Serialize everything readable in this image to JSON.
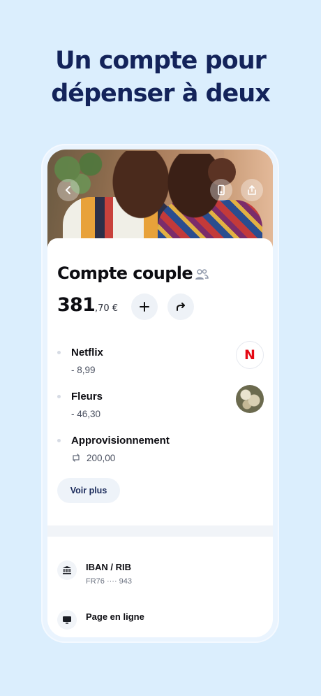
{
  "headline": {
    "line1": "Un compte pour",
    "line2": "dépenser à deux"
  },
  "colors": {
    "background": "#dbeefd",
    "headline": "#13235a",
    "netflix": "#e50914"
  },
  "account": {
    "title": "Compte couple",
    "balance_int": "381",
    "balance_dec": ",70 €"
  },
  "transactions": [
    {
      "name": "Netflix",
      "amount": "- 8,99",
      "thumb_text": "N",
      "icon": "netflix-logo"
    },
    {
      "name": "Fleurs",
      "amount": "- 46,30",
      "icon": "flowers-photo"
    },
    {
      "name": "Approvisionnement",
      "amount": "200,00",
      "icon": "recurring-icon"
    }
  ],
  "buttons": {
    "voir_plus": "Voir plus"
  },
  "info": {
    "iban_label": "IBAN / RIB",
    "iban_value": "FR76 ···· 943",
    "online_label": "Page en ligne"
  }
}
